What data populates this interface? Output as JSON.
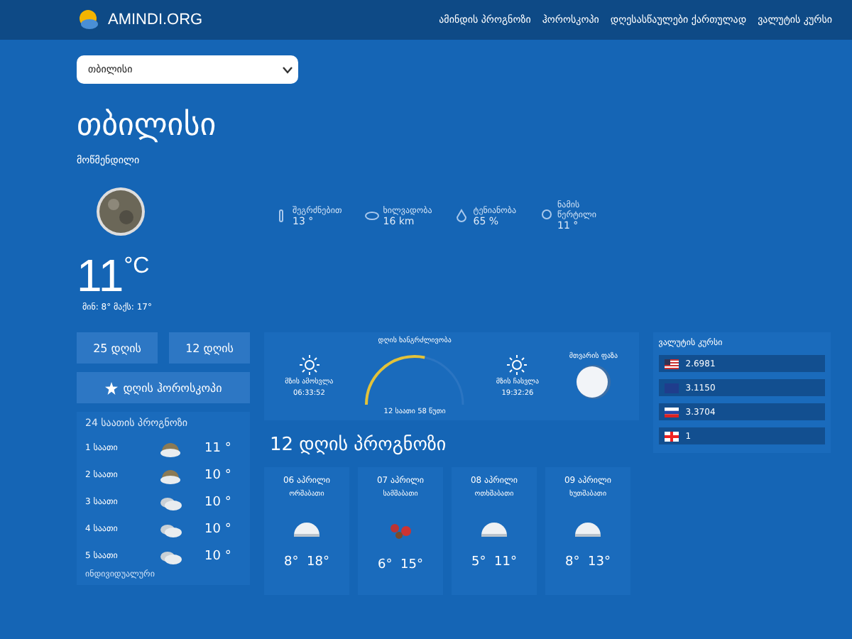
{
  "brand": "AMINDI.ORG",
  "nav": [
    "ამინდის პროგნოზი",
    "ჰოროსკოპი",
    "დღესასწაულები ქართულად",
    "ვალუტის კურსი"
  ],
  "city_select": {
    "value": "თბილისი"
  },
  "city": "თბილისი",
  "condition": "მოწმენდილი",
  "stats": [
    {
      "kind": "feels",
      "label": "შეგრძნებით",
      "value": "13 °"
    },
    {
      "kind": "visibility",
      "label": "ხილვადობა",
      "value": "16 km"
    },
    {
      "kind": "humidity",
      "label": "ტენიანობა",
      "value": "65 %"
    },
    {
      "kind": "dew",
      "label": "ნამის წერტილი",
      "value": "11 °"
    }
  ],
  "temperature": "11",
  "unit": "°C",
  "minmax": "მინ: 8° მაქს: 17°",
  "buttons": [
    "25 დღის",
    "12 დღის"
  ],
  "horoscope_button": "დღის ჰოროსკოპი",
  "hourly": {
    "title": "24 საათის პროგნოზი",
    "rows": [
      {
        "time": "1 საათი",
        "kind": "partly",
        "temp": "11 °"
      },
      {
        "time": "2 საათი",
        "kind": "partly",
        "temp": "10 °"
      },
      {
        "time": "3 საათი",
        "kind": "cloudy",
        "temp": "10 °"
      },
      {
        "time": "4 საათი",
        "kind": "cloudy",
        "temp": "10 °"
      },
      {
        "time": "5 საათი",
        "kind": "cloudy",
        "temp": "10 °"
      }
    ],
    "more": "ინდივიდუალური"
  },
  "sun": {
    "rise_label": "მზის ამოსვლა",
    "rise": "06:33:52",
    "day_label": "დღის ხანგრძლივობა",
    "day_length": "12 საათი 58 წუთი",
    "set_label": "მზის ჩასვლა",
    "set": "19:32:26"
  },
  "moon": {
    "label": "მთვარის ფაზა"
  },
  "currency": {
    "title": "ვალუტის კურსი",
    "rates": [
      {
        "kind": "us",
        "value": "2.6981"
      },
      {
        "kind": "eu",
        "value": "3.1150"
      },
      {
        "kind": "tri",
        "value": "3.3704"
      },
      {
        "kind": "ge",
        "value": "1"
      }
    ]
  },
  "forecast": {
    "title": "12 დღის პროგნოზი",
    "days": [
      {
        "date": "06 აპრილი",
        "weekday": "ორშაბათი",
        "kind": "cloud",
        "temps": "8°  18°"
      },
      {
        "date": "07 აპრილი",
        "weekday": "სამშაბათი",
        "kind": "berries",
        "temps": "6°  15°"
      },
      {
        "date": "08 აპრილი",
        "weekday": "ოთხშაბათი",
        "kind": "cloud",
        "temps": "5°  11°"
      },
      {
        "date": "09 აპრილი",
        "weekday": "ხუთშაბათი",
        "kind": "cloud",
        "temps": "8°  13°"
      }
    ]
  }
}
